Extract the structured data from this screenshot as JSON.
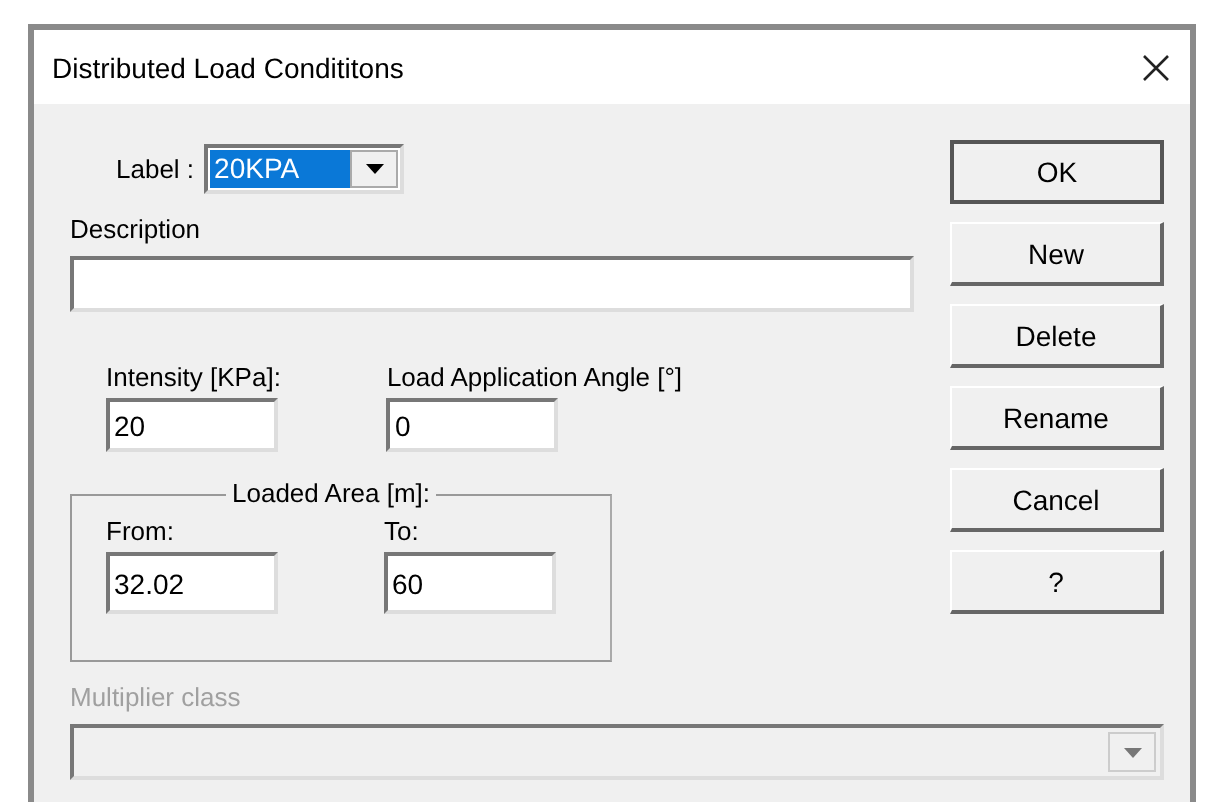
{
  "window": {
    "title": "Distributed Load Condititons"
  },
  "label_combo": {
    "label": "Label :",
    "value": "20KPA",
    "text_selected": true
  },
  "description": {
    "label": "Description"
  },
  "intensity": {
    "label": "Intensity [KPa]:",
    "value": "20"
  },
  "angle": {
    "label": "Load Application Angle [°]",
    "value": "0"
  },
  "loaded_area": {
    "title": "Loaded Area [m]:",
    "fields": [
      {
        "label": "From:",
        "value": "32.02"
      },
      {
        "label": "To:",
        "value": "60"
      }
    ]
  },
  "multiplier_class": {
    "label": "Multiplier class",
    "disabled": true
  },
  "buttons": [
    {
      "label": "OK",
      "default": true
    },
    {
      "label": "New",
      "default": false
    },
    {
      "label": "Delete",
      "default": false
    },
    {
      "label": "Rename",
      "default": false
    },
    {
      "label": "Cancel",
      "default": false
    },
    {
      "label": "?",
      "default": false
    }
  ]
}
